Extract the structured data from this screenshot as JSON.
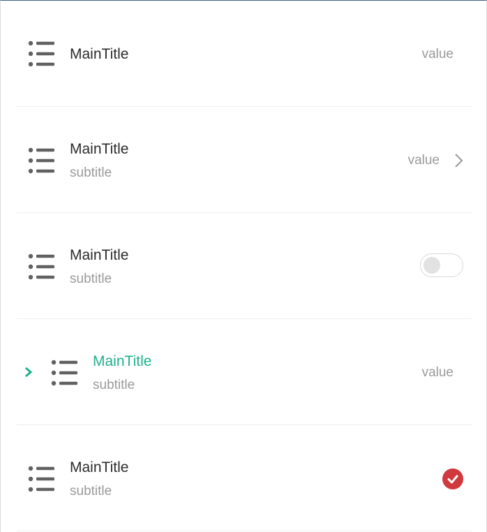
{
  "colors": {
    "accent": "#1fb08c",
    "title": "#2b2b2b",
    "muted": "#9a9a9a",
    "icon": "#616161",
    "check": "#d0393e"
  },
  "rows": [
    {
      "icon": "list-icon",
      "title": "MainTitle",
      "value": "value"
    },
    {
      "icon": "list-icon",
      "title": "MainTitle",
      "subtitle": "subtitle",
      "value": "value",
      "trailing": "chevron-right-icon"
    },
    {
      "icon": "list-icon",
      "title": "MainTitle",
      "subtitle": "subtitle",
      "trailing": "toggle",
      "toggle_on": false
    },
    {
      "icon": "list-icon",
      "title": "MainTitle",
      "subtitle": "subtitle",
      "value": "value",
      "leading": "chevron-right-icon",
      "active": true
    },
    {
      "icon": "list-icon",
      "title": "MainTitle",
      "subtitle": "subtitle",
      "trailing": "check-icon",
      "checked": true
    }
  ]
}
